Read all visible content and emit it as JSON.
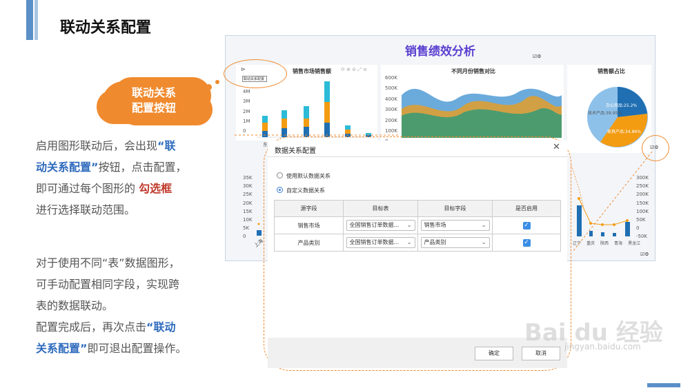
{
  "slide": {
    "title": "联动关系配置",
    "callout": {
      "line1": "联动关系",
      "line2": "配置按钮"
    },
    "para1": {
      "t1": "启用图形联动后，会出现",
      "h1a": "“联",
      "h1b": "动关系配置”",
      "t2": "按钮，点击配置，",
      "t3": "即可通过每个图形的",
      "h2": "勾选框",
      "t4": "进行选择联动范围。"
    },
    "para2": {
      "l1": "对于使用不同“表”数据图形，",
      "l2": "可手动配置相同字段，实现跨",
      "l3": "表的数据联动。",
      "l4a": "配置完成后，再次点击",
      "h1": "“联动",
      "h2": "关系配置”",
      "l5": "即可退出配置操作。"
    }
  },
  "dashboard": {
    "title": "销售绩效分析",
    "chart1_title": "销售市场销售额",
    "link_button": "联动关系配置",
    "chart2_title": "不同月份销售对比",
    "chart3_title": "销售额占比",
    "left_axis": [
      "35K",
      "30K",
      "25K",
      "20K",
      "15K",
      "10K",
      "5K",
      "0"
    ],
    "right_axis": [
      "300K",
      "250K",
      "200K",
      "150K",
      "100K",
      "50K",
      "0",
      "-50K"
    ],
    "bar_axis": [
      "4M",
      "3M",
      "2M",
      "1M",
      "0"
    ],
    "area_axis": [
      "600K",
      "500K",
      "400K",
      "300K",
      "200K",
      "100K",
      "0"
    ],
    "pie_labels": [
      "办公用品:25.2%",
      "技术产品:39.95%",
      "家具产品:34.86%"
    ],
    "x_first": "东北",
    "x_bottom_first": "上海",
    "x_bottom_right": [
      "辽宁",
      "重庆",
      "陕西",
      "青海",
      "黑龙江"
    ]
  },
  "dialog": {
    "title": "数据关系配置",
    "close": "✕",
    "radio_default": "使用默认数据关系",
    "radio_custom": "自定义数据关系",
    "headers": [
      "源字段",
      "目标表",
      "目标字段",
      "是否启用"
    ],
    "rows": [
      {
        "source": "销售市场",
        "table": "全国销售订单数据...",
        "field": "销售市场",
        "enabled": "✓"
      },
      {
        "source": "产品类别",
        "table": "全国销售订单数据...",
        "field": "产品类别",
        "enabled": "✓"
      }
    ],
    "ok": "确定",
    "cancel": "取消"
  },
  "watermark": {
    "main": "Bai du 经验",
    "sub": "jingyan.baidu.com"
  },
  "colors": {
    "accent_orange": "#f08a2e",
    "title_purple": "#5b3fd1",
    "highlight_blue": "#2f6bbd",
    "highlight_red": "#c0392b"
  }
}
